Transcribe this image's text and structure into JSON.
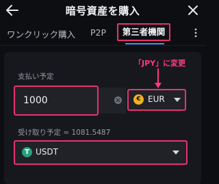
{
  "header": {
    "title": "暗号資産を購入"
  },
  "tabs": [
    {
      "label": "ワンクリック購入"
    },
    {
      "label": "P2P"
    },
    {
      "label": "第三者機関"
    }
  ],
  "pay": {
    "label": "支払い予定",
    "amount": "1000",
    "currency": "EUR",
    "currency_icon_glyph": "€"
  },
  "annotation": {
    "text": "「JPY」に変更",
    "color": "#ff3a7a"
  },
  "receive": {
    "label": "受け取り予定 ≈ 1081.5487",
    "currency": "USDT",
    "currency_icon_glyph": "T"
  },
  "colors": {
    "highlight": "#e8336e",
    "tab_underline": "#4f8cf7",
    "background": "#0d0e12",
    "card": "#17181d"
  },
  "icons": {
    "back": "back-arrow-icon",
    "close": "close-icon",
    "more": "more-vertical-icon",
    "clear": "clear-icon",
    "eur": "eur-coin-icon",
    "usdt": "usdt-coin-icon",
    "dropdown": "chevron-down-icon"
  }
}
